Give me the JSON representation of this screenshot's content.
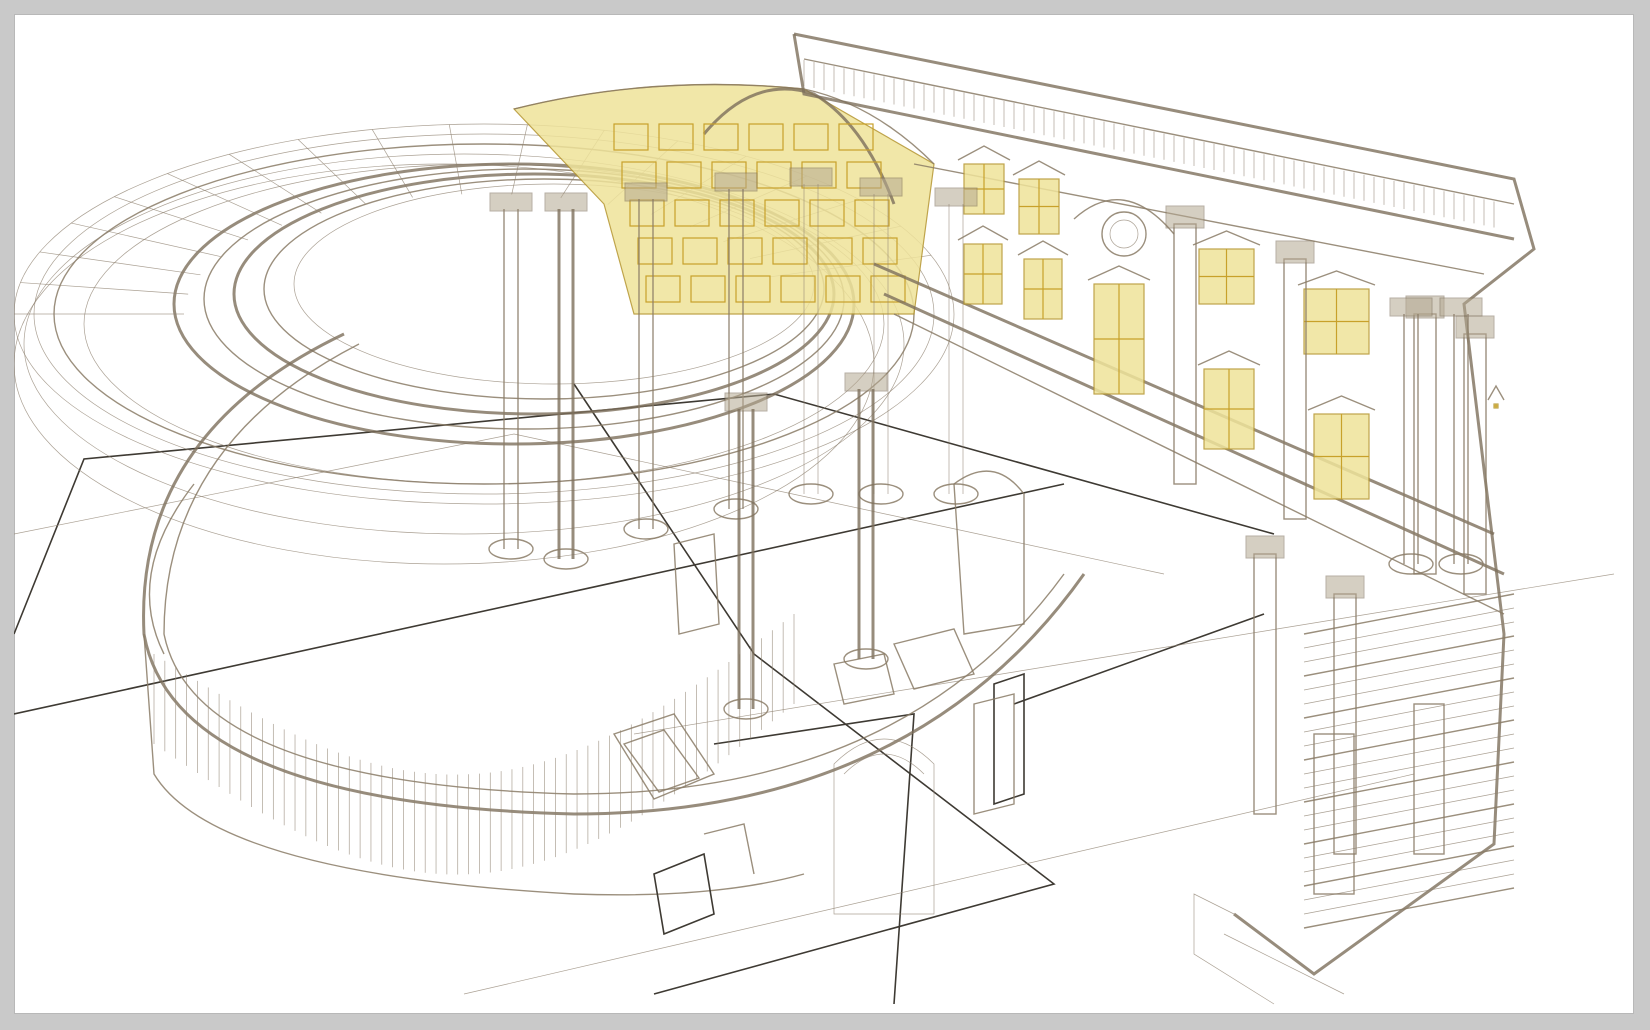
{
  "viewport": {
    "background": "#ffffff",
    "frame_color": "#c9c9c9",
    "line_color": "#8a7b66",
    "accent_line_color": "#3e3a33",
    "glazing_color": "#c8a12a"
  }
}
